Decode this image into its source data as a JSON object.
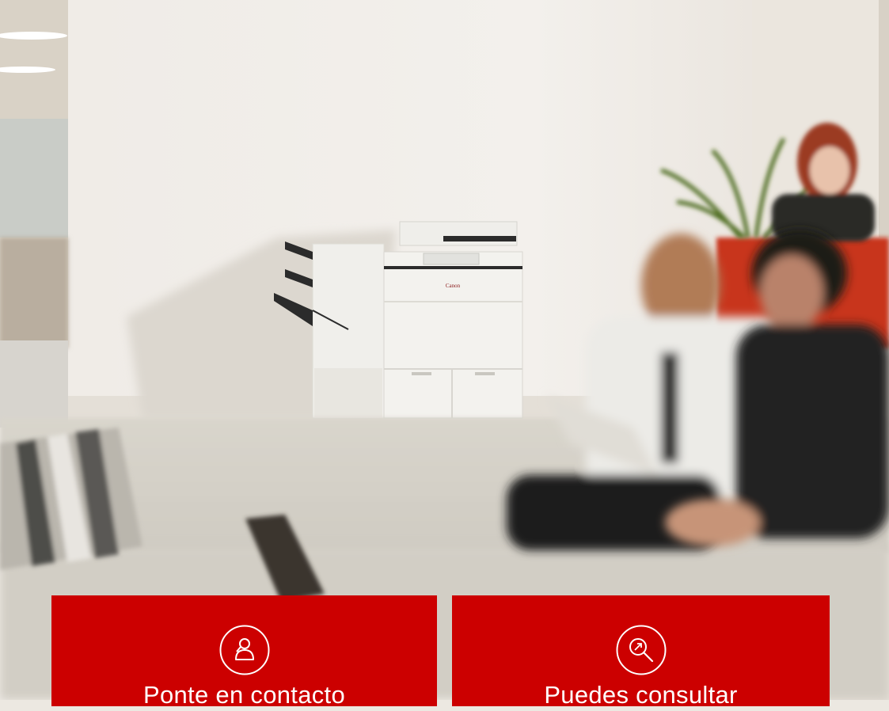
{
  "hero": {
    "brand_label": "Canon",
    "scene_description_icon": "office-photo"
  },
  "cta": [
    {
      "label": "Ponte en contacto",
      "icon": "contact-person-icon"
    },
    {
      "label": "Puedes consultar",
      "icon": "search-explore-icon"
    }
  ],
  "colors": {
    "brand_red": "#cc0000",
    "text_on_red": "#ffffff"
  }
}
